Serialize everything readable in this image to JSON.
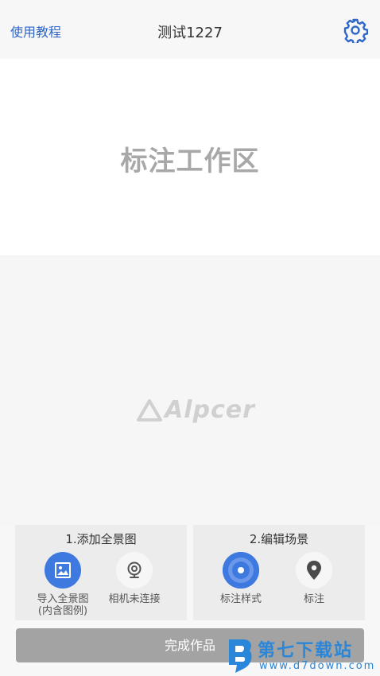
{
  "header": {
    "tutorial_label": "使用教程",
    "title": "测试1227",
    "settings_icon": "gear-icon"
  },
  "work_area": {
    "label": "标注工作区"
  },
  "preview": {
    "brand": "Alpcer"
  },
  "panels": [
    {
      "title": "1.添加全景图",
      "tools": [
        {
          "label": "导入全景图",
          "sublabel": "(内含图例)",
          "icon": "image-import-icon"
        },
        {
          "label": "相机未连接",
          "icon": "camera-icon"
        }
      ]
    },
    {
      "title": "2.编辑场景",
      "tools": [
        {
          "label": "标注样式",
          "icon": "target-icon"
        },
        {
          "label": "标注",
          "icon": "location-pin-icon"
        }
      ]
    }
  ],
  "finish_button": {
    "label": "完成作品"
  },
  "watermark": {
    "name": "第七下载站",
    "url": "www.d7down.com"
  },
  "colors": {
    "accent": "#3e79e0",
    "link": "#2f66c8",
    "finish_disabled": "#a3a3a3",
    "watermark": "#2a86d8"
  }
}
